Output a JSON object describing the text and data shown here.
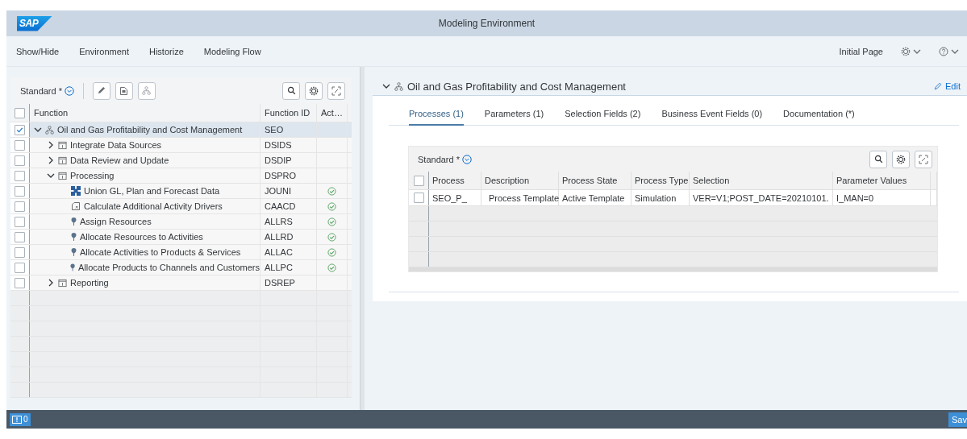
{
  "header": {
    "logo": "SAP",
    "title": "Modeling Environment"
  },
  "menu": {
    "items": [
      "Show/Hide",
      "Environment",
      "Historize",
      "Modeling Flow"
    ],
    "initial_page": "Initial Page"
  },
  "function_panel": {
    "variant": "Standard *",
    "select_all_checked": false,
    "columns": [
      "Function",
      "Function ID",
      "Act…"
    ],
    "rows": [
      {
        "label": "Oil and Gas Profitability and Cost Management",
        "function_id": "SEO",
        "kind": "model",
        "expanded": true,
        "checked": true,
        "selected": true,
        "active": false,
        "children": [
          {
            "label": "Integrate Data Sources",
            "function_id": "DSIDS",
            "kind": "folder",
            "expanded": false,
            "checked": false,
            "selected": false,
            "active": false
          },
          {
            "label": "Data Review and Update",
            "function_id": "DSDIP",
            "kind": "folder",
            "expanded": false,
            "checked": false,
            "selected": false,
            "active": false
          },
          {
            "label": "Processing",
            "function_id": "DSPRO",
            "kind": "folder",
            "expanded": true,
            "checked": false,
            "selected": false,
            "active": false,
            "children": [
              {
                "label": "Union GL, Plan and Forecast Data",
                "function_id": "JOUNI",
                "kind": "union",
                "checked": false,
                "selected": false,
                "active": true
              },
              {
                "label": "Calculate Additional Activity Drivers",
                "function_id": "CAACD",
                "kind": "calculation",
                "checked": false,
                "selected": false,
                "active": true
              },
              {
                "label": "Assign Resources",
                "function_id": "ALLRS",
                "kind": "allocation",
                "checked": false,
                "selected": false,
                "active": true
              },
              {
                "label": "Allocate Resources to Activities",
                "function_id": "ALLRD",
                "kind": "allocation",
                "checked": false,
                "selected": false,
                "active": true
              },
              {
                "label": "Allocate Activities to Products & Services",
                "function_id": "ALLAC",
                "kind": "allocation",
                "checked": false,
                "selected": false,
                "active": true
              },
              {
                "label": "Allocate Products to Channels and Customers",
                "function_id": "ALLPC",
                "kind": "allocation",
                "checked": false,
                "selected": false,
                "active": true
              }
            ]
          },
          {
            "label": "Reporting",
            "function_id": "DSREP",
            "kind": "folder",
            "expanded": false,
            "checked": false,
            "selected": false,
            "active": false
          }
        ]
      }
    ]
  },
  "detail": {
    "expanded": true,
    "title": "Oil and Gas Profitability and Cost Management",
    "edit": "Edit",
    "tabs": [
      {
        "label": "Processes (1)",
        "selected": true
      },
      {
        "label": "Parameters (1)",
        "selected": false
      },
      {
        "label": "Selection Fields (2)",
        "selected": false
      },
      {
        "label": "Business Event Fields (0)",
        "selected": false
      },
      {
        "label": "Documentation (*)",
        "selected": false
      }
    ],
    "process_table": {
      "variant": "Standard *",
      "select_all_checked": false,
      "columns": [
        "Process",
        "Description",
        "Process State",
        "Process Type",
        "Selection",
        "Parameter Values"
      ],
      "rows": [
        {
          "checked": false,
          "cells": [
            "SEO_P_",
            "Process Template",
            "Active Template",
            "Simulation",
            "VER=V1;POST_DATE=20210101.",
            "I_MAN=0"
          ]
        }
      ]
    }
  },
  "footer": {
    "message_count": "0",
    "save": "Sav"
  }
}
